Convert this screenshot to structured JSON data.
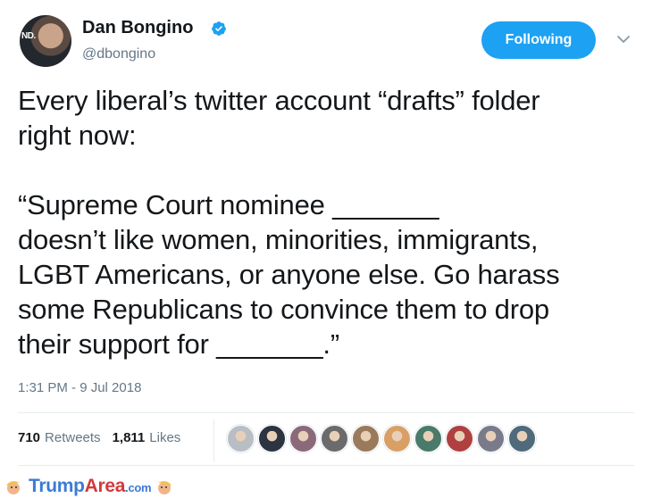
{
  "author": {
    "name": "Dan Bongino",
    "handle": "@dbongino",
    "avatar_text": "ND."
  },
  "follow_button": {
    "label": "Following"
  },
  "tweet": {
    "text": "Every liberal’s twitter account “drafts” folder\nright now:\n\n“Supreme Court nominee _______\ndoesn’t like women, minorities, immigrants,\nLGBT Americans, or anyone else. Go harass\nsome Republicans to convince them to drop\ntheir support for _______.”",
    "timestamp": "1:31 PM - 9 Jul 2018"
  },
  "stats": {
    "retweets_count": "710",
    "retweets_label": "Retweets",
    "likes_count": "1,811",
    "likes_label": "Likes"
  },
  "likers": [
    {
      "color": "#b8bec4"
    },
    {
      "color": "#2b3440"
    },
    {
      "color": "#8a6a7a"
    },
    {
      "color": "#6b6b6b"
    },
    {
      "color": "#9a7a5a"
    },
    {
      "color": "#d9a066"
    },
    {
      "color": "#4a7a6a"
    },
    {
      "color": "#b04040"
    },
    {
      "color": "#7a7a8a"
    },
    {
      "color": "#4f6a7a"
    }
  ],
  "watermark": {
    "brand_main": "Trump",
    "brand_area": "Area",
    "brand_tld": ".com"
  },
  "colors": {
    "accent": "#1da1f2",
    "secondary_text": "#657786"
  }
}
